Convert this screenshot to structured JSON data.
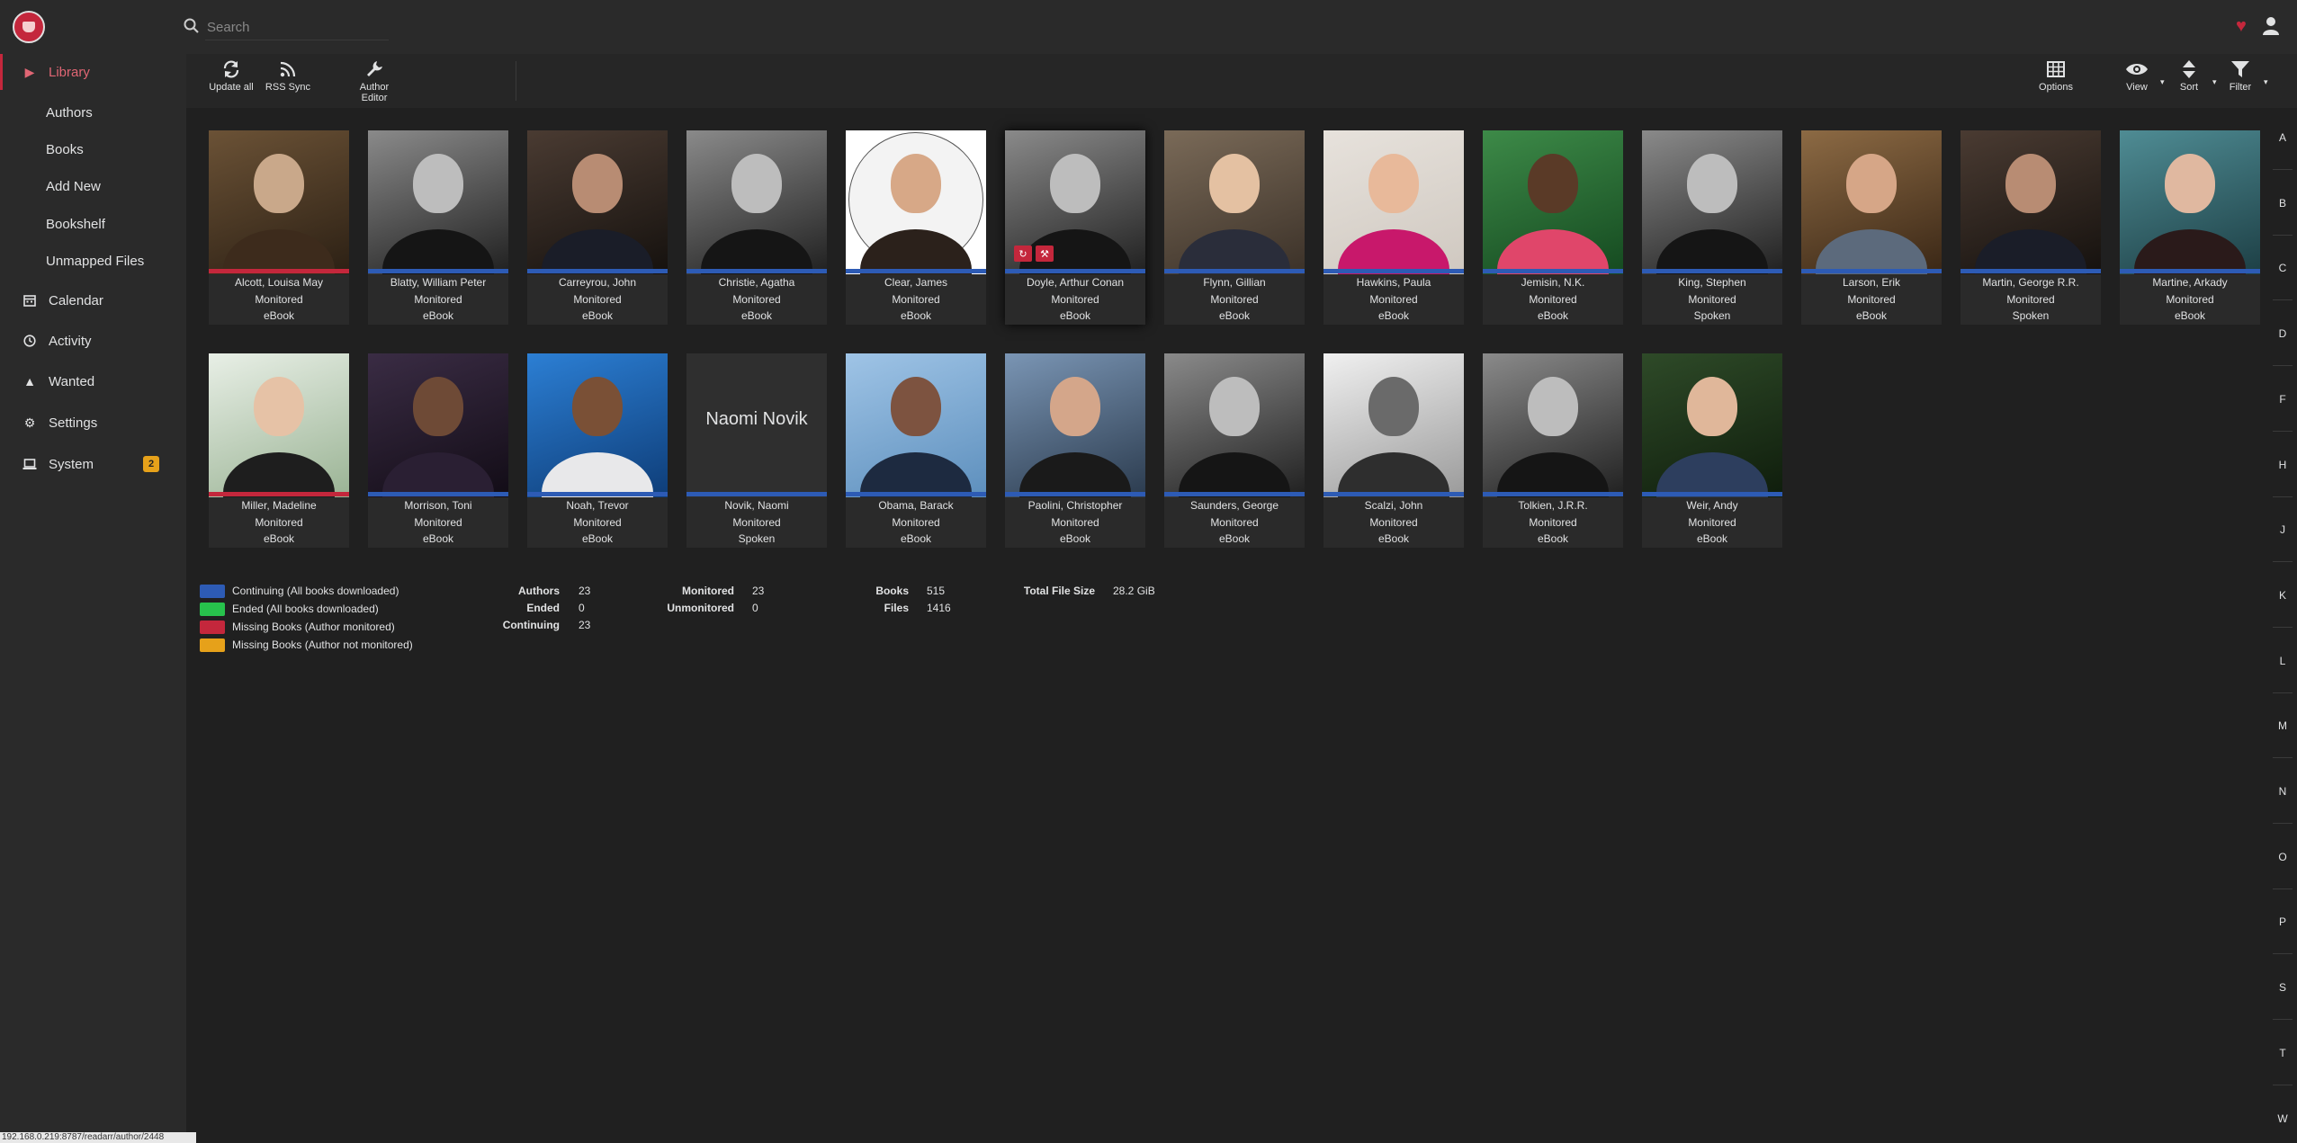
{
  "header": {
    "search_placeholder": "Search",
    "icons": [
      "logo",
      "search-icon",
      "heart-icon",
      "user-icon"
    ]
  },
  "sidebar": {
    "items": [
      {
        "label": "Library",
        "icon": "play-icon",
        "active": true
      },
      {
        "label": "Authors",
        "sub": true
      },
      {
        "label": "Books",
        "sub": true
      },
      {
        "label": "Add New",
        "sub": true
      },
      {
        "label": "Bookshelf",
        "sub": true
      },
      {
        "label": "Unmapped Files",
        "sub": true
      },
      {
        "label": "Calendar",
        "icon": "calendar-icon"
      },
      {
        "label": "Activity",
        "icon": "clock-icon"
      },
      {
        "label": "Wanted",
        "icon": "warning-icon"
      },
      {
        "label": "Settings",
        "icon": "gears-icon"
      },
      {
        "label": "System",
        "icon": "laptop-icon",
        "badge": "2"
      }
    ]
  },
  "toolbar": {
    "update_all": "Update all",
    "rss_sync": "RSS Sync",
    "author_editor_1": "Author",
    "author_editor_2": "Editor",
    "options": "Options",
    "view": "View",
    "sort": "Sort",
    "filter": "Filter"
  },
  "authors": [
    {
      "name": "Alcott, Louisa May",
      "monitored": "Monitored",
      "format": "eBook",
      "status": "missing-monitored",
      "tone": "sepia"
    },
    {
      "name": "Blatty, William Peter",
      "monitored": "Monitored",
      "format": "eBook",
      "status": "continuing",
      "tone": "bw"
    },
    {
      "name": "Carreyrou, John",
      "monitored": "Monitored",
      "format": "eBook",
      "status": "continuing",
      "tone": "dark"
    },
    {
      "name": "Christie, Agatha",
      "monitored": "Monitored",
      "format": "eBook",
      "status": "continuing",
      "tone": "bw"
    },
    {
      "name": "Clear, James",
      "monitored": "Monitored",
      "format": "eBook",
      "status": "continuing",
      "tone": "circle"
    },
    {
      "name": "Doyle, Arthur Conan",
      "monitored": "Monitored",
      "format": "eBook",
      "status": "continuing",
      "tone": "bw",
      "hover": true
    },
    {
      "name": "Flynn, Gillian",
      "monitored": "Monitored",
      "format": "eBook",
      "status": "continuing",
      "tone": "warm"
    },
    {
      "name": "Hawkins, Paula",
      "monitored": "Monitored",
      "format": "eBook",
      "status": "continuing",
      "tone": "pink"
    },
    {
      "name": "Jemisin, N.K.",
      "monitored": "Monitored",
      "format": "eBook",
      "status": "continuing",
      "tone": "green"
    },
    {
      "name": "King, Stephen",
      "monitored": "Monitored",
      "format": "Spoken",
      "status": "continuing",
      "tone": "bw"
    },
    {
      "name": "Larson, Erik",
      "monitored": "Monitored",
      "format": "eBook",
      "status": "continuing",
      "tone": "brown"
    },
    {
      "name": "Martin, George R.R.",
      "monitored": "Monitored",
      "format": "Spoken",
      "status": "continuing",
      "tone": "dark"
    },
    {
      "name": "Martine, Arkady",
      "monitored": "Monitored",
      "format": "eBook",
      "status": "continuing",
      "tone": "teal"
    },
    {
      "name": "Miller, Madeline",
      "monitored": "Monitored",
      "format": "eBook",
      "status": "missing-monitored",
      "tone": "white"
    },
    {
      "name": "Morrison, Toni",
      "monitored": "Monitored",
      "format": "eBook",
      "status": "continuing",
      "tone": "purple"
    },
    {
      "name": "Noah, Trevor",
      "monitored": "Monitored",
      "format": "eBook",
      "status": "continuing",
      "tone": "blue"
    },
    {
      "name": "Novik, Naomi",
      "monitored": "Monitored",
      "format": "Spoken",
      "status": "continuing",
      "tone": "placeholder",
      "placeholder": "Naomi Novik"
    },
    {
      "name": "Obama, Barack",
      "monitored": "Monitored",
      "format": "eBook",
      "status": "continuing",
      "tone": "sky"
    },
    {
      "name": "Paolini, Christopher",
      "monitored": "Monitored",
      "format": "eBook",
      "status": "continuing",
      "tone": "dusk"
    },
    {
      "name": "Saunders, George",
      "monitored": "Monitored",
      "format": "eBook",
      "status": "continuing",
      "tone": "bw"
    },
    {
      "name": "Scalzi, John",
      "monitored": "Monitored",
      "format": "eBook",
      "status": "continuing",
      "tone": "sketch"
    },
    {
      "name": "Tolkien, J.R.R.",
      "monitored": "Monitored",
      "format": "eBook",
      "status": "continuing",
      "tone": "bw"
    },
    {
      "name": "Weir, Andy",
      "monitored": "Monitored",
      "format": "eBook",
      "status": "continuing",
      "tone": "leaf"
    }
  ],
  "legend": [
    {
      "label": "Continuing (All books downloaded)",
      "color": "#2d5bb5"
    },
    {
      "label": "Ended (All books downloaded)",
      "color": "#27c24c"
    },
    {
      "label": "Missing Books (Author monitored)",
      "color": "#c4273c"
    },
    {
      "label": "Missing Books (Author not monitored)",
      "color": "#e6a11a"
    }
  ],
  "stats": {
    "authors_label": "Authors",
    "authors": "23",
    "ended_label": "Ended",
    "ended": "0",
    "continuing_label": "Continuing",
    "continuing": "23",
    "monitored_label": "Monitored",
    "monitored": "23",
    "unmonitored_label": "Unmonitored",
    "unmonitored": "0",
    "books_label": "Books",
    "books": "515",
    "files_label": "Files",
    "files": "1416",
    "size_label": "Total File Size",
    "size": "28.2 GiB"
  },
  "jump_bar": [
    "A",
    "B",
    "C",
    "D",
    "F",
    "H",
    "J",
    "K",
    "L",
    "M",
    "N",
    "O",
    "P",
    "S",
    "T",
    "W"
  ],
  "browser_status": "192.168.0.219:8787/readarr/author/2448"
}
